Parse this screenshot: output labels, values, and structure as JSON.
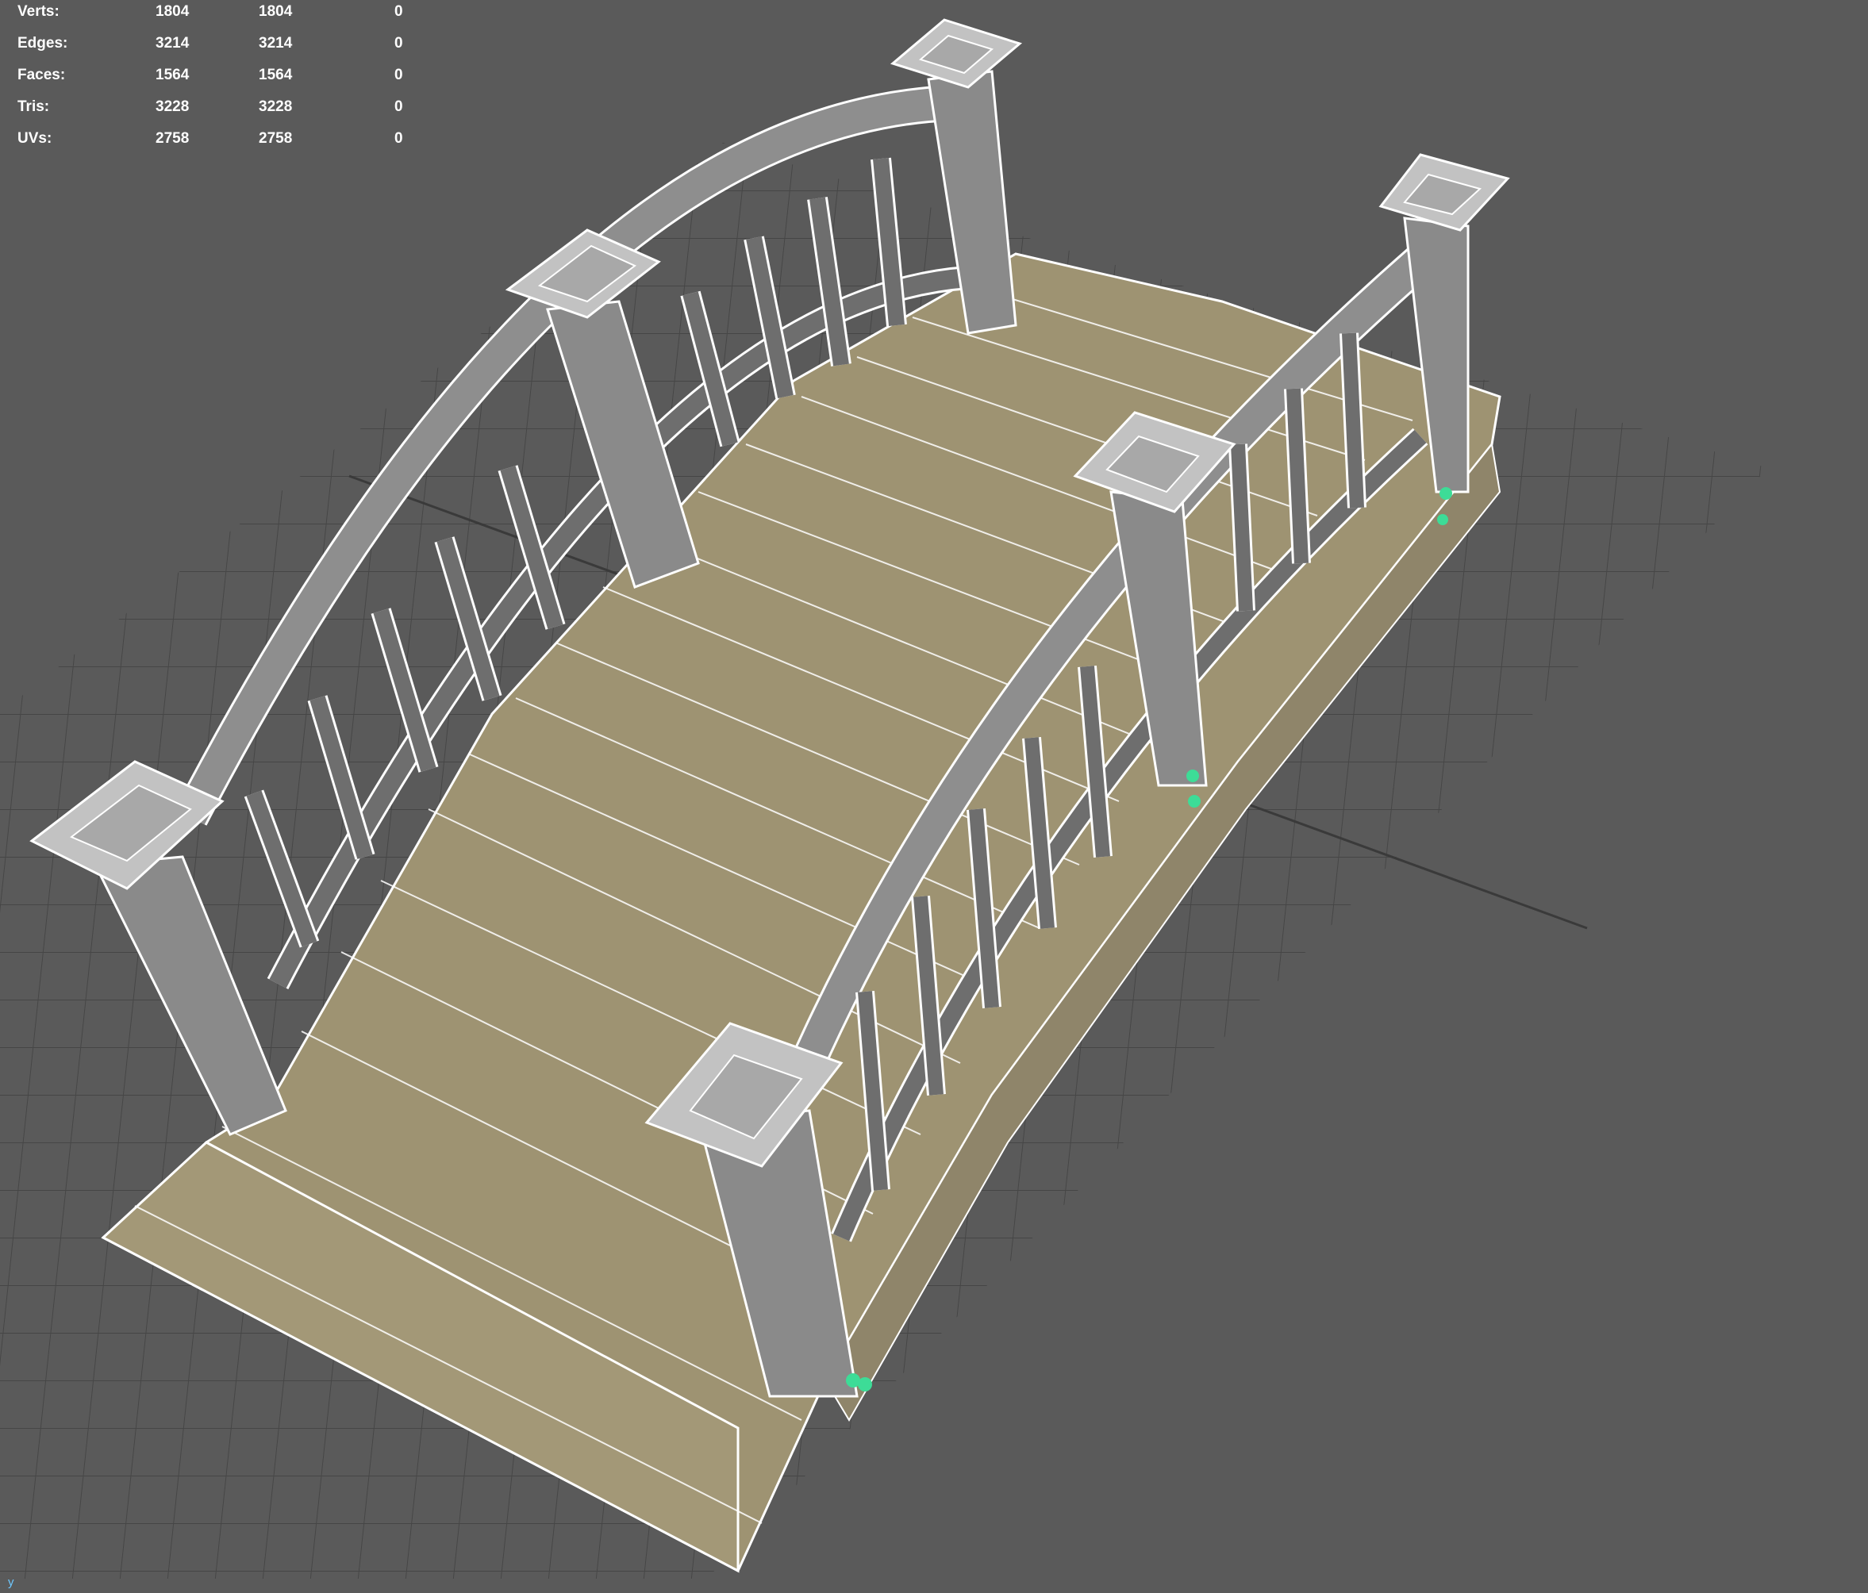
{
  "hud": {
    "rows": [
      {
        "label": "Verts:",
        "total": "1804",
        "selected": "1804",
        "extra": "0"
      },
      {
        "label": "Edges:",
        "total": "3214",
        "selected": "3214",
        "extra": "0"
      },
      {
        "label": "Faces:",
        "total": "1564",
        "selected": "1564",
        "extra": "0"
      },
      {
        "label": "Tris:",
        "total": "3228",
        "selected": "3228",
        "extra": "0"
      },
      {
        "label": "UVs:",
        "total": "2758",
        "selected": "2758",
        "extra": "0"
      }
    ]
  },
  "axis": {
    "label": "y"
  },
  "colors": {
    "background": "#5a5a5a",
    "grid": "#414141",
    "wood": "#9e9372",
    "wireframe": "#ffffff",
    "post": "#9a9a9a",
    "selected_vertex": "#3ddc97"
  }
}
